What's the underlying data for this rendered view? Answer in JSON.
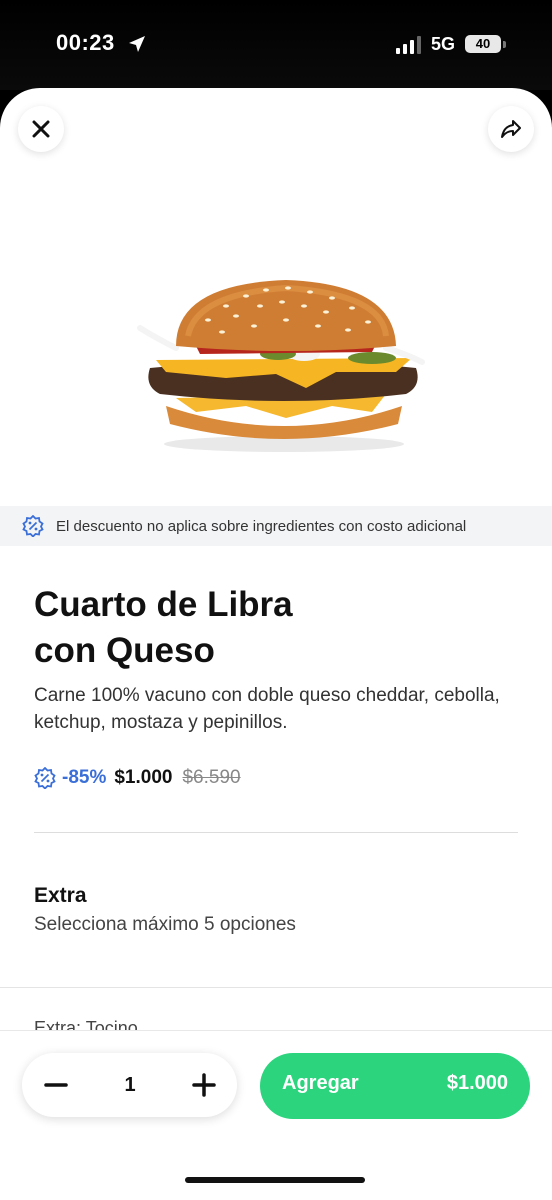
{
  "status_bar": {
    "time": "00:23",
    "network": "5G",
    "battery": "40"
  },
  "header": {
    "close_icon": "close-icon",
    "share_icon": "share-icon"
  },
  "notice": {
    "text": "El descuento no aplica sobre ingredientes con costo adicional",
    "icon": "discount-badge-icon"
  },
  "product": {
    "title_line1": "Cuarto de Libra",
    "title_line2": "con Queso",
    "description": "Carne 100% vacuno con doble queso cheddar, cebolla, ketchup, mostaza y pepinillos.",
    "discount": "-85%",
    "price": "$1.000",
    "original_price": "$6.590"
  },
  "extras": {
    "title": "Extra",
    "subtitle": "Selecciona máximo 5 opciones",
    "first_item": "Extra: Tocino"
  },
  "footer": {
    "quantity": "1",
    "add_label": "Agregar",
    "add_price": "$1.000"
  },
  "colors": {
    "accent_green": "#2bd47d",
    "discount_blue": "#3b6fd8"
  }
}
